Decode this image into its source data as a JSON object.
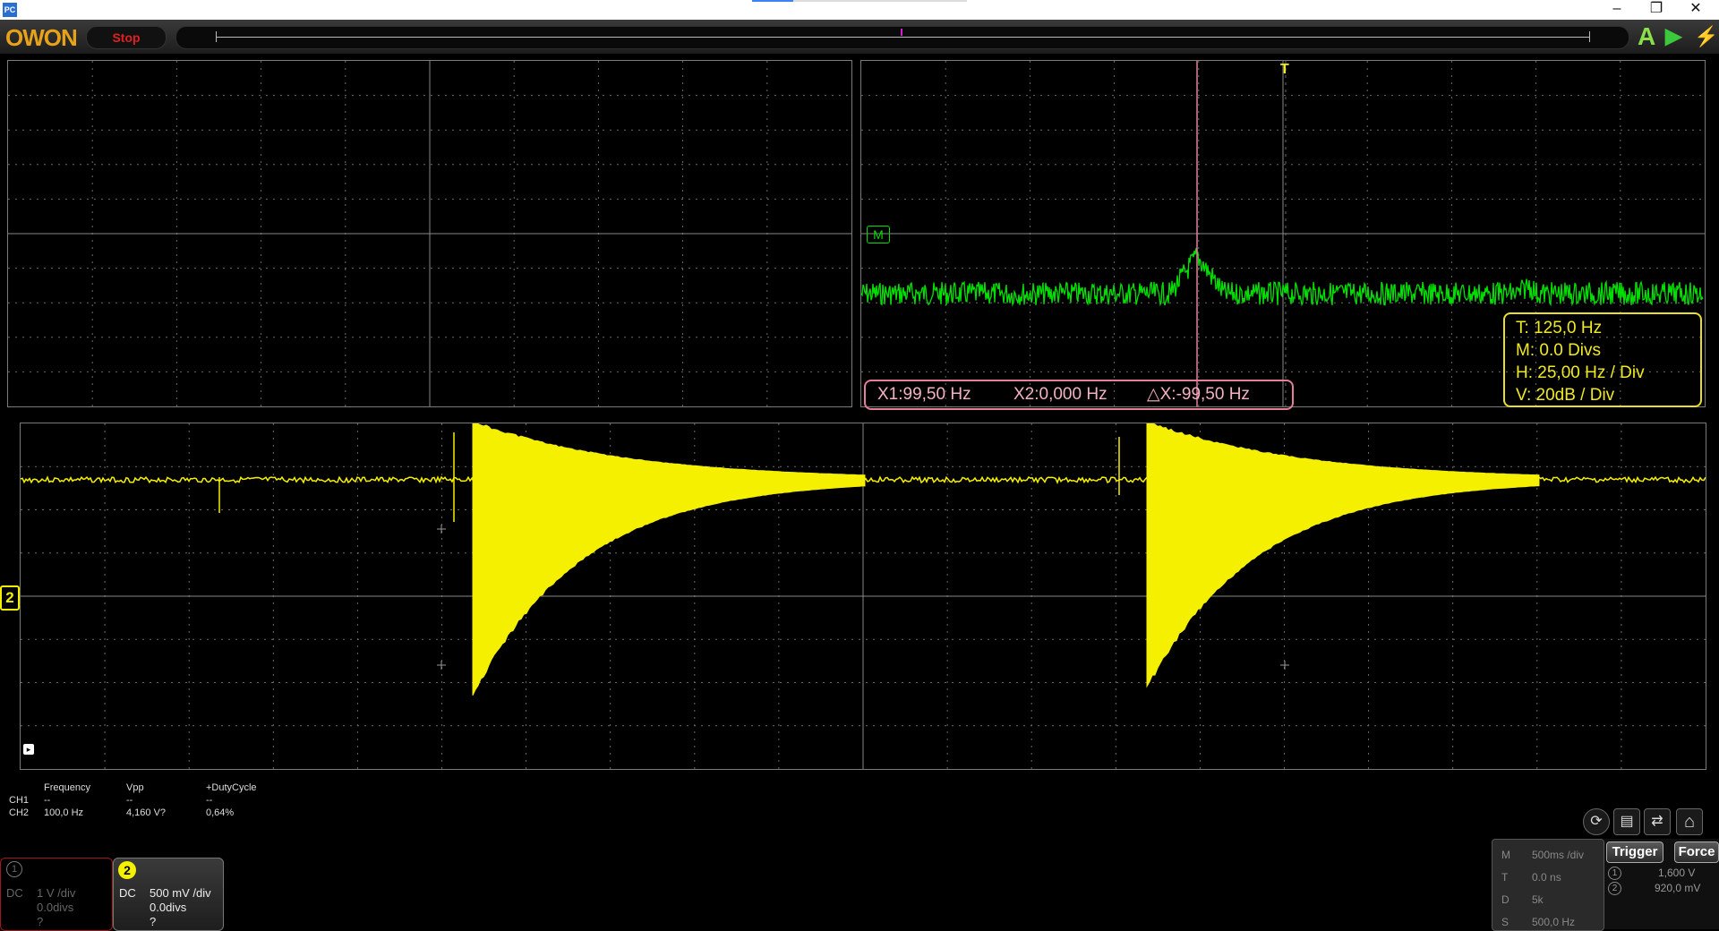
{
  "window": {
    "app_icon": "PC",
    "buttons": {
      "minimize": "–",
      "restore": "❐",
      "close": "✕"
    }
  },
  "toolbar": {
    "logo": "OWON",
    "run_state": "Stop",
    "auto_icon": "auto-set-icon",
    "run_icon": "play-icon",
    "lightning_icon": "lightning-icon"
  },
  "colors": {
    "ch1": "#e02020",
    "ch2": "#f5f000",
    "math": "#00e000",
    "cursor": "#e37f9a",
    "trigger": "#f0ea20",
    "grid": "#6a6a6a"
  },
  "fft": {
    "marker_label": "M",
    "trigger_label": "T",
    "cursor_readout": {
      "x1": "X1:99,50 Hz",
      "x2": "X2:0,000 Hz",
      "dx": "△X:-99,50 Hz"
    },
    "info": {
      "t": "T: 125,0 Hz",
      "m": "M: 0.0 Divs",
      "h": "H: 25,00 Hz / Div",
      "v": "V: 20dB  / Div"
    }
  },
  "waveform": {
    "channel_marker": "2",
    "trigger_marker": "▸"
  },
  "measurements": {
    "headers": [
      "Frequency",
      "Vpp",
      "+DutyCycle"
    ],
    "rows": [
      {
        "channel": "CH1",
        "frequency": "--",
        "vpp": "--",
        "duty": "--"
      },
      {
        "channel": "CH2",
        "frequency": "100,0 Hz",
        "vpp": "4,160 V?",
        "duty": "0,64%"
      }
    ]
  },
  "channels": [
    {
      "number": "1",
      "coupling": "DC",
      "scale": "1 V /div",
      "offset": "0.0divs",
      "probe": "?"
    },
    {
      "number": "2",
      "coupling": "DC",
      "scale": "500 mV /div",
      "offset": "0.0divs",
      "probe": "?"
    }
  ],
  "horizontal": {
    "m_label": "M",
    "m_value": "500ms /div",
    "t_label": "T",
    "t_value": "0.0 ns",
    "d_label": "D",
    "d_value": "5k",
    "s_label": "S",
    "s_value": "500,0 Hz"
  },
  "trigger": {
    "trigger_button": "Trigger",
    "force_button": "Force",
    "level1_id": "1",
    "level1": "1,600 V",
    "level2_id": "2",
    "level2": "920,0 mV"
  },
  "icon_bar": [
    "refresh-icon",
    "save-icon",
    "export-icon",
    "home-icon"
  ]
}
